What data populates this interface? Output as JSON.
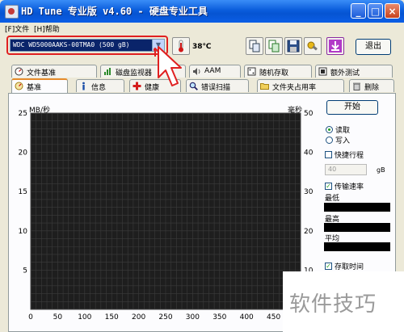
{
  "window": {
    "title": "HD Tune 专业版 v4.60 - 硬盘专业工具",
    "controls": [
      "_",
      "□",
      "×"
    ]
  },
  "menu": [
    "[F]文件",
    "[H]帮助"
  ],
  "toolbar": {
    "drive": "WDC WD5000AAKS-00TMA0 (500 gB)",
    "temperature": "38℃",
    "exit_label": "退出",
    "buttons": [
      "copy-icon",
      "copy-all-icon",
      "save-icon",
      "options-icon",
      "download-icon"
    ]
  },
  "tabs_row1": [
    "文件基准",
    "磁盘监视器",
    "AAM",
    "随机存取",
    "额外测试"
  ],
  "tabs_row2": [
    "基准",
    "信息",
    "健康",
    "错误扫描",
    "文件夹占用率",
    "删除"
  ],
  "active_tab": "基准",
  "chart_data": {
    "type": "line",
    "left_axis_label": "MB/秒",
    "right_axis_label": "毫秒",
    "left_ticks": [
      25,
      20,
      15,
      10,
      5
    ],
    "right_ticks": [
      50,
      40,
      30,
      20,
      10
    ],
    "x_ticks": [
      0,
      50,
      100,
      150,
      200,
      250,
      300,
      350,
      400,
      450
    ],
    "x_range": [
      0,
      500
    ],
    "left_range": [
      0,
      25
    ],
    "right_range": [
      0,
      50
    ],
    "series": [],
    "grid": true,
    "background": "#1e1e1e"
  },
  "controls": {
    "start_label": "开始",
    "read_label": "读取",
    "write_label": "写入",
    "short_stroke_label": "快捷行程",
    "stroke_value": "40",
    "stroke_unit": "gB",
    "transfer_rate_label": "传输速率",
    "min_label": "最低",
    "max_label": "最高",
    "avg_label": "平均",
    "access_time_label": "存取时间"
  },
  "watermark": "软件技巧",
  "colors": {
    "accent_border": "#e02020",
    "titlebar": "#0a5ddc",
    "chart_bg": "#1e1e1e"
  }
}
